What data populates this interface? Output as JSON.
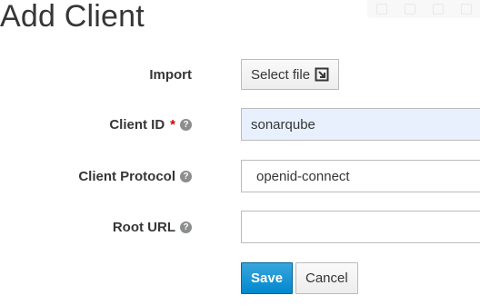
{
  "page": {
    "title": "Add Client"
  },
  "form": {
    "import": {
      "label": "Import",
      "button_label": "Select file",
      "button_icon": "import-icon"
    },
    "client_id": {
      "label": "Client ID",
      "required_mark": "*",
      "help_icon": "question-circle-icon",
      "value": "sonarqube"
    },
    "client_protocol": {
      "label": "Client Protocol",
      "help_icon": "question-circle-icon",
      "value": "openid-connect"
    },
    "root_url": {
      "label": "Root URL",
      "help_icon": "question-circle-icon",
      "value": ""
    }
  },
  "actions": {
    "save_label": "Save",
    "cancel_label": "Cancel"
  },
  "colors": {
    "primary": "#0088ce",
    "required": "#cc0000",
    "autofill_bg": "#e8f0fe"
  }
}
